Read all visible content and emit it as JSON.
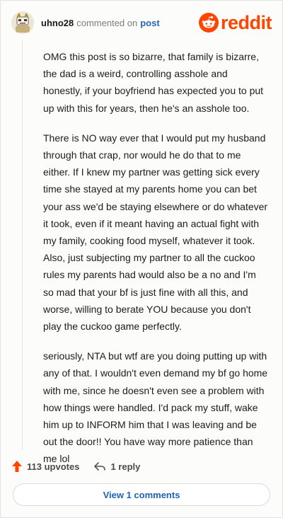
{
  "header": {
    "username": "uhno28",
    "commented_on": "commented on",
    "post_link": "post",
    "brand": "reddit"
  },
  "comment": {
    "paragraphs": [
      "OMG this post is so bizarre, that family is bizarre, the dad is a weird, controlling asshole and honestly, if your boyfriend has expected you to put up with this for years, then he's an asshole too.",
      "There is NO way ever that I would put my husband through that crap, nor would he do that to me either. If I knew my partner was getting sick every time she stayed at my parents home you can bet your ass we'd be staying elsewhere or do whatever it took, even if it meant having an actual fight with my family, cooking food myself, whatever it took. Also, just subjecting my partner to all the cuckoo rules my parents had would also be a no and I'm so mad that your bf is just fine with all this, and worse, willing to berate YOU because you don't play the cuckoo game perfectly.",
      "seriously, NTA but wtf are you doing putting up with any of that. I wouldn't even demand my bf go home with me, since he doesn't even see a problem with how things were handled. I'd pack my stuff, wake him up to INFORM him that I was leaving and be out the door!! You have way more patience than me lol"
    ]
  },
  "actions": {
    "upvotes": "113 upvotes",
    "replies": "1 reply"
  },
  "footer": {
    "view_comments": "View 1 comments"
  },
  "colors": {
    "brand_orange": "#ff4500",
    "link_blue": "#1f63b6"
  },
  "icons": {
    "upvote": "upvote-arrow-icon",
    "reply": "reply-arrow-icon",
    "logo": "reddit-snoo-icon"
  }
}
